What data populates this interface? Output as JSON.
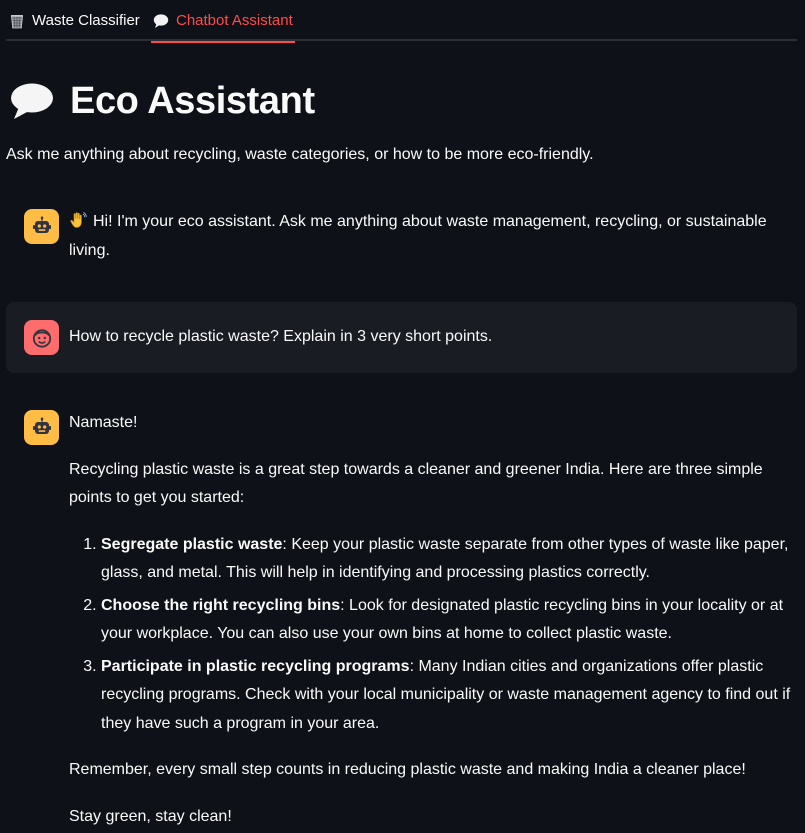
{
  "tabs": [
    {
      "label": "Waste Classifier",
      "icon": "wastebasket-icon",
      "active": false
    },
    {
      "label": "Chatbot Assistant",
      "icon": "speech-balloon-icon",
      "active": true
    }
  ],
  "page": {
    "title": "Eco Assistant",
    "title_icon": "speech-balloon-icon",
    "subtitle": "Ask me anything about recycling, waste categories, or how to be more eco-friendly."
  },
  "messages": [
    {
      "role": "assistant",
      "avatar_icon": "robot-icon",
      "text": "Hi! I'm your eco assistant. Ask me anything about waste management, recycling, or sustainable living."
    },
    {
      "role": "user",
      "avatar_icon": "smiley-face-icon",
      "text": "How to recycle plastic waste? Explain in 3 very short points."
    },
    {
      "role": "assistant",
      "avatar_icon": "robot-icon",
      "greeting": "Namaste!",
      "intro": "Recycling plastic waste is a great step towards a cleaner and greener India. Here are three simple points to get you started:",
      "points": [
        {
          "title": "Segregate plastic waste",
          "body": ": Keep your plastic waste separate from other types of waste like paper, glass, and metal. This will help in identifying and processing plastics correctly."
        },
        {
          "title": "Choose the right recycling bins",
          "body": ": Look for designated plastic recycling bins in your locality or at your workplace. You can also use your own bins at home to collect plastic waste."
        },
        {
          "title": "Participate in plastic recycling programs",
          "body": ": Many Indian cities and organizations offer plastic recycling programs. Check with your local municipality or waste management agency to find out if they have such a program in your area."
        }
      ],
      "closing": "Remember, every small step counts in reducing plastic waste and making India a cleaner place!",
      "signoff": "Stay green, stay clean!"
    }
  ],
  "colors": {
    "background": "#0e1117",
    "text": "#fafafa",
    "accent": "#ff4b4b",
    "assistant_avatar": "#ffbd45",
    "user_avatar": "#ff6c6c",
    "user_message_bg": "#1a1c24"
  }
}
